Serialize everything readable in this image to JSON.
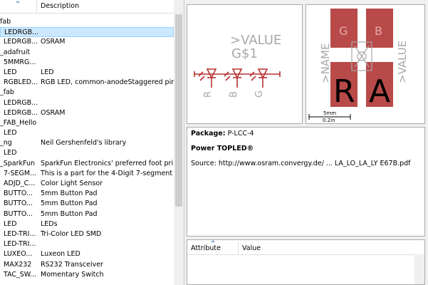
{
  "library": {
    "columns": {
      "name": "",
      "description": "Description"
    },
    "rows": [
      {
        "name": "fab",
        "desc": "",
        "indent": 0
      },
      {
        "name": "LEDRGB...",
        "desc": "",
        "indent": 1,
        "selected": true
      },
      {
        "name": "LEDRGB...",
        "desc": "OSRAM",
        "indent": 1
      },
      {
        "name": "_adafruit",
        "desc": "",
        "indent": 0
      },
      {
        "name": "5MMRG...",
        "desc": "",
        "indent": 1
      },
      {
        "name": "LED",
        "desc": "LED",
        "indent": 1
      },
      {
        "name": "RGBLED...",
        "desc": "RGB LED, common-anodeStaggered pins",
        "indent": 1
      },
      {
        "name": "_fab",
        "desc": "",
        "indent": 0
      },
      {
        "name": "LEDRGB...",
        "desc": "",
        "indent": 1
      },
      {
        "name": "LEDRGB...",
        "desc": "OSRAM",
        "indent": 1
      },
      {
        "name": "_FAB_Hello",
        "desc": "",
        "indent": 0
      },
      {
        "name": "LED",
        "desc": "",
        "indent": 1
      },
      {
        "name": "_ng",
        "desc": "Neil Gershenfeld's library",
        "indent": 0
      },
      {
        "name": "LED",
        "desc": "",
        "indent": 1
      },
      {
        "name": "_SparkFun",
        "desc": "SparkFun Electronics' preferred foot prints",
        "indent": 0
      },
      {
        "name": "7-SEGM...",
        "desc": "This is a part for the 4-Digit 7-segment L...",
        "indent": 1
      },
      {
        "name": "ADJD_C...",
        "desc": "Color Light Sensor",
        "indent": 1
      },
      {
        "name": "BUTTO...",
        "desc": "5mm Button Pad",
        "indent": 1
      },
      {
        "name": "BUTTO...",
        "desc": "5mm Button Pad",
        "indent": 1
      },
      {
        "name": "BUTTO...",
        "desc": "5mm Button Pad",
        "indent": 1
      },
      {
        "name": "LED",
        "desc": "LEDs",
        "indent": 1
      },
      {
        "name": "LED-TRI...",
        "desc": "Tri-Color LED SMD",
        "indent": 1
      },
      {
        "name": "LED-TRI...",
        "desc": "",
        "indent": 1
      },
      {
        "name": "LUXEO...",
        "desc": "Luxeon LED",
        "indent": 1
      },
      {
        "name": "MAX232",
        "desc": "RS232 Transceiver",
        "indent": 1
      },
      {
        "name": "TAC_SW...",
        "desc": "Momentary Switch",
        "indent": 1
      }
    ]
  },
  "symbol": {
    "value_label": ">VALUE",
    "name_label": "G$1",
    "pins": [
      "R",
      "B",
      "G"
    ]
  },
  "package": {
    "pad_letters_small": [
      "G",
      "B"
    ],
    "pad_letters_large": [
      "R",
      "A"
    ],
    "name_label": ">NAME",
    "value_label": ">VALUE",
    "scale_mm": "5mm",
    "scale_in": "0.2in"
  },
  "info": {
    "package_label": "Package:",
    "package_value": "P-LCC-4",
    "title": "Power TOPLED®",
    "source": "Source: http://www.osram.convergy.de/ ... LA_LO_LA_LY E67B.pdf"
  },
  "attributes": {
    "col_attribute": "Attribute",
    "col_value": "Value"
  },
  "colors": {
    "pad": "#b94a4a",
    "symbol": "#b83232",
    "label_gray": "#a8a8a8",
    "selection": "#cce8ff"
  }
}
